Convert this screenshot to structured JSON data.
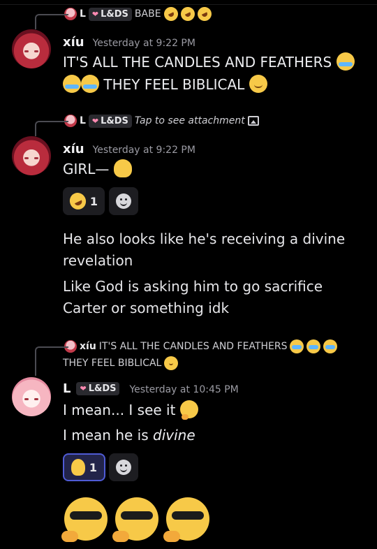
{
  "reply1": {
    "name": "L",
    "tag": "L&DS",
    "text": "BABE"
  },
  "msg1": {
    "author": "xíu",
    "time": "Yesterday at 9:22 PM",
    "line1": "IT'S ALL THE CANDLES AND FEATHERS",
    "line2": "THEY FEEL BIBLICAL"
  },
  "reply2": {
    "name": "L",
    "tag": "L&DS",
    "text": "Tap to see attachment"
  },
  "msg2": {
    "author": "xíu",
    "time": "Yesterday at 9:22 PM",
    "text": "GIRL—",
    "reaction_count": "1",
    "follow1": "He also looks like he's receiving a divine revelation",
    "follow2": "Like God is asking him to go sacrifice Carter or something idk"
  },
  "reply3": {
    "name": "xíu",
    "text1": "IT'S ALL THE CANDLES AND FEATHERS",
    "text2": "THEY FEEL BIBLICAL"
  },
  "msg3": {
    "author": "L",
    "tag": "L&DS",
    "time": "Yesterday at 10:45 PM",
    "line1": "I mean... I see it",
    "line2_prefix": "I mean he is ",
    "line2_em": "divine",
    "reaction_count": "1"
  },
  "icons": {
    "heart": "heart-icon",
    "sob": "loudly-crying-face-icon",
    "relieved": "relieved-face-icon",
    "melting": "melting-face-icon",
    "thinking": "thinking-face-icon",
    "rofl": "rolling-on-floor-laughing-icon",
    "cool": "cool-face-icon",
    "image": "image-icon",
    "add_reaction": "add-reaction-icon"
  },
  "colors": {
    "background": "#000000",
    "tag_heart": "#ff8ab2",
    "active_reaction_border": "#4f5bd5"
  }
}
